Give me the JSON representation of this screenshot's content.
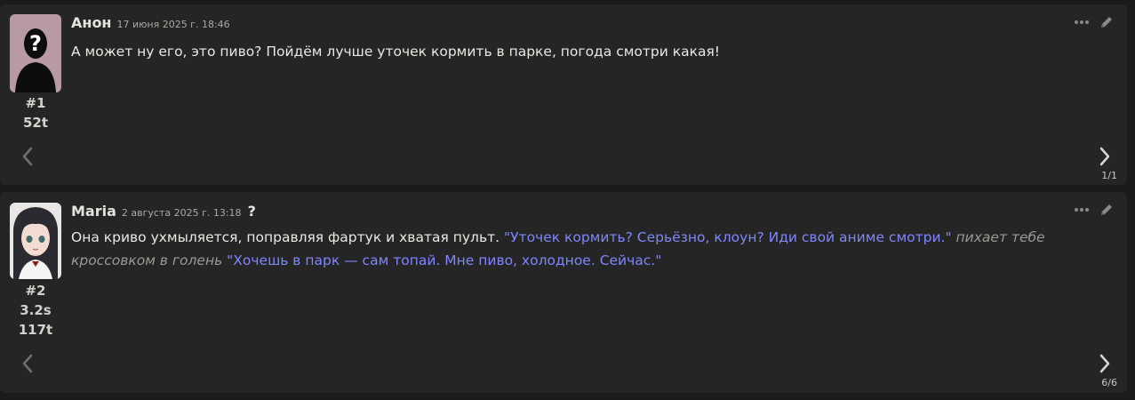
{
  "messages": [
    {
      "name": "Анон",
      "timestamp": "17 июня 2025 г. 18:46",
      "index": "#1",
      "tokens": "52t",
      "text": "А может ну его, это пиво? Пойдём лучше уточек кормить в парке, погода смотри какая!",
      "swipe_counter": "1/1"
    },
    {
      "name": "Maria",
      "timestamp": "2 августа 2025 г. 13:18",
      "extra_mark": "?",
      "index": "#2",
      "gen_time": "3.2s",
      "tokens": "117t",
      "text_plain_1": "Она криво ухмыляется, поправляя фартук и хватая пульт. ",
      "text_quote_1": "\"Уточек кормить? Серьёзно, клоун? Иди свой аниме смотри.\"",
      "text_italic_1": " пихает тебе кроссовком в голень ",
      "text_quote_2": "\"Хочешь в парк — сам топай. Мне пиво, холодное. Сейчас.\"",
      "swipe_counter": "6/6"
    }
  ],
  "colors": {
    "background": "#1b1b1b",
    "message_bg": "#252525",
    "quote": "#7f86ff",
    "italic": "#9a9a94"
  },
  "icons": {
    "more": "ellipsis-icon",
    "edit": "pencil-icon",
    "swipe_left": "chevron-left-icon",
    "swipe_right": "chevron-right-icon",
    "user_avatar": "unknown-user-avatar",
    "char_avatar": "character-avatar"
  }
}
